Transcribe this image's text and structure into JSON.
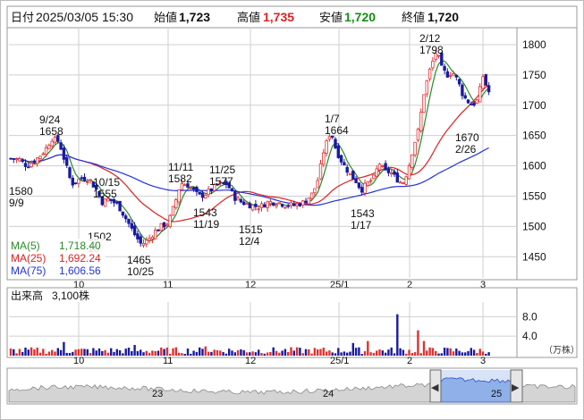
{
  "header": {
    "date_label": "日付",
    "datetime": "2025/03/05 15:30",
    "open_label": "始値",
    "open_value": "1,723",
    "high_label": "高値",
    "high_value": "1,735",
    "low_label": "安値",
    "low_value": "1,720",
    "close_label": "終値",
    "close_value": "1,720"
  },
  "colors": {
    "up": "#e03030",
    "down": "#1a1aa0",
    "high": "#e02020",
    "low": "#109010",
    "ma5": "#2a8a2a",
    "ma25": "#e02020",
    "ma75": "#2233dd",
    "volume": "#1a1aa0",
    "grid": "#cfcfcf"
  },
  "legend": [
    {
      "label": "MA(5)",
      "value": "1,718.40",
      "color": "#2a8a2a"
    },
    {
      "label": "MA(25)",
      "value": "1,692.24",
      "color": "#e02020"
    },
    {
      "label": "MA(75)",
      "value": "1,606.56",
      "color": "#2233dd"
    }
  ],
  "price_axis": {
    "ticks": [
      "1800",
      "1750",
      "1700",
      "1650",
      "1600",
      "1550",
      "1500",
      "1450"
    ]
  },
  "date_axis": {
    "labels": [
      "10",
      "11",
      "12",
      "25/1",
      "2",
      "3"
    ]
  },
  "annotations": [
    {
      "text": "9/24",
      "sub": "1658"
    },
    {
      "text": "1580",
      "sub": "9/9"
    },
    {
      "text": "10/15",
      "sub": "1555"
    },
    {
      "text": "1502",
      "sub": "10"
    },
    {
      "text": "1465",
      "sub": "10/25"
    },
    {
      "text": "11/11",
      "sub": "1582"
    },
    {
      "text": "1543",
      "sub": "11/19"
    },
    {
      "text": "11/25",
      "sub": "1577"
    },
    {
      "text": "1515",
      "sub": "12/4"
    },
    {
      "text": "1/7",
      "sub": "1664"
    },
    {
      "text": "1543",
      "sub": "1/17"
    },
    {
      "text": "2/12",
      "sub": "1798"
    },
    {
      "text": "1670",
      "sub": "2/26"
    }
  ],
  "volume_panel": {
    "title": "出来高",
    "value": "3,100株",
    "ticks": [
      "8.0",
      "4.0"
    ],
    "unit": "（万株）"
  },
  "navigator": {
    "labels": [
      "23",
      "24",
      "25"
    ],
    "left_arrow": "◀",
    "right_arrow": "▶"
  },
  "chart_data": {
    "type": "candlestick",
    "y_range": [
      1415,
      1825
    ],
    "volume_range": [
      0,
      11
    ],
    "tick_values": [
      1800,
      1750,
      1700,
      1650,
      1600,
      1550,
      1500,
      1450
    ],
    "annotation_prices": [
      1658,
      1580,
      1555,
      1502,
      1465,
      1582,
      1543,
      1577,
      1515,
      1664,
      1543,
      1798,
      1670
    ]
  }
}
